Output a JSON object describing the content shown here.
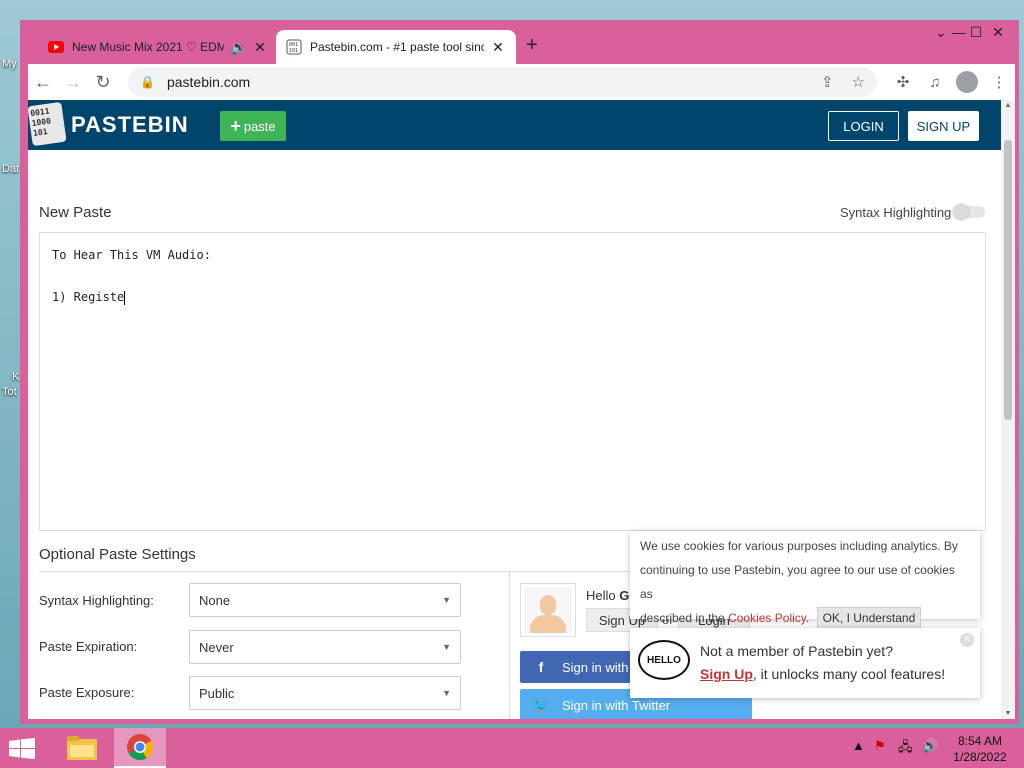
{
  "desktop": {
    "icons": [
      "My",
      "Dat",
      "K",
      "Tot"
    ]
  },
  "browser": {
    "tabs": [
      {
        "title": "New Music Mix 2021 ♡ EDM",
        "favicon": "youtube-icon",
        "audio": true
      },
      {
        "title": "Pastebin.com - #1 paste tool since",
        "favicon": "pastebin-icon",
        "active": true
      }
    ],
    "url": "pastebin.com"
  },
  "header": {
    "logo_text": "PASTEBIN",
    "logo_digits": "0011\n1000\n101",
    "paste_label": "paste",
    "login_label": "LOGIN",
    "signup_label": "SIGN UP"
  },
  "editor": {
    "title": "New Paste",
    "syntax_toggle_label": "Syntax Highlighting",
    "syntax_toggle_on": false,
    "lines": [
      "To Hear This VM Audio:",
      "",
      "1) Registe"
    ]
  },
  "settings": {
    "title": "Optional Paste Settings",
    "rows": [
      {
        "label": "Syntax Highlighting:",
        "value": "None"
      },
      {
        "label": "Paste Expiration:",
        "value": "Never"
      },
      {
        "label": "Paste Exposure:",
        "value": "Public"
      }
    ]
  },
  "user_panel": {
    "hello": "Hello",
    "hello_bold": "G",
    "signup_label": "Sign Up",
    "or_text": "or",
    "login_label": "Login",
    "facebook_label": "Sign in with F",
    "twitter_label": "Sign in with Twitter"
  },
  "cookie": {
    "text1": "We use cookies for various purposes including analytics. By",
    "text2": "continuing to use Pastebin, you agree to our use of cookies as",
    "text3": "described in the",
    "link": "Cookies Policy",
    "ok_label": "OK, I Understand"
  },
  "member": {
    "bubble": "HELLO",
    "question": "Not a member of Pastebin yet?",
    "signup": "Sign Up",
    "rest": ", it unlocks many cool features!"
  },
  "taskbar": {
    "time": "8:54 AM",
    "date": "1/28/2022"
  },
  "colors": {
    "window_frame": "#d9609a",
    "pastebin_header": "#02456c",
    "paste_button": "#3fb558",
    "facebook": "#4267b2",
    "twitter": "#55acee",
    "link_red": "#c2362e"
  }
}
